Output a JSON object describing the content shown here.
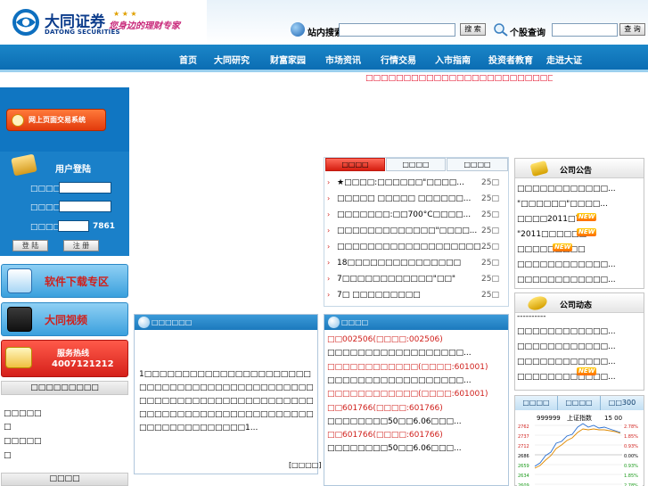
{
  "header": {
    "logo_cn": "大同证券",
    "logo_en": "DATONG SECURITIES",
    "slogan": "您身边的理财专家",
    "site_search_label": "站内搜索",
    "site_search_button": "搜 索",
    "stock_query_label": "个股查询",
    "stock_query_button": "查 询"
  },
  "nav": {
    "items": [
      "首页",
      "大同研究",
      "财富家园",
      "市场资讯",
      "行情交易",
      "入市指南",
      "投资者教育",
      "走进大证"
    ]
  },
  "ticker": "□□□□□□□□□□□□□□□□□□□□□□□□□□□□□□□□□□□□□□□□□□",
  "left": {
    "trade_button": "网上页面交易系统",
    "login": {
      "title": "用户登陆",
      "username_label": "□□□□",
      "password_label": "□□□□",
      "captcha_label": "□□□□",
      "captcha_code": "7861",
      "login_button": "登 陆",
      "register_button": "注 册"
    },
    "download": "软件下载专区",
    "video": "大同视频",
    "hotline_title": "服务热线",
    "hotline_number": "4007121212",
    "section1": "□□□□□□□□□",
    "lines": [
      "□□□□□",
      "□",
      "□□□□□",
      "□"
    ],
    "section2": "□□□□"
  },
  "news": {
    "tabs": [
      "□□□□",
      "□□□□",
      "□□□□"
    ],
    "items": [
      {
        "title": "★□□□□:□□□□□□\"□□□□...",
        "date": "25□"
      },
      {
        "title": "□□□□□ □□□□□ □□□□□□...",
        "date": "25□"
      },
      {
        "title": "□□□□□□□:□□700°C□□□□...",
        "date": "25□"
      },
      {
        "title": "□□□□□□□□□□□□□\"□□□□...",
        "date": "25□"
      },
      {
        "title": "□□□□□□□□□□□□□□□□□□□...",
        "date": "25□"
      },
      {
        "title": "18□□□□□□□□□□□□□□□",
        "date": "25□"
      },
      {
        "title": "7□□□□□□□□□□□□\"□□\"",
        "date": "25□"
      },
      {
        "title": "7□ □□□□□□□□□",
        "date": "25□"
      }
    ]
  },
  "announcements": {
    "title": "公司公告",
    "items": [
      "□□□□□□□□□□□□...",
      "\"□□□□□□\"□□□□...",
      "□□□□2011□7...",
      "\"2011□□□□□□...",
      "□□□□□□□□□",
      "□□□□□□□□□□□□...",
      "□□□□□□□□□□□□...",
      "□□□□□□□□□□□□"
    ],
    "new_badge": "NEW"
  },
  "dynamics": {
    "title": "公司动态",
    "items": [
      "----------",
      "□□□□□□□□□□□□...",
      "□□□□□□□□□□□□...",
      "□□□□□□□□□□□□...",
      "□□□□□□□□□□□□..."
    ]
  },
  "index": {
    "tabs": [
      "□□□□",
      "□□□□",
      "□□300"
    ],
    "code": "999999",
    "name": "上证指数",
    "time": "15 00",
    "left_axis": [
      "2762",
      "2737",
      "2712",
      "2686",
      "2659",
      "2634",
      "2609"
    ],
    "right_axis": [
      "2.78%",
      "1.85%",
      "0.93%",
      "0.00%",
      "0.93%",
      "1.85%",
      "2.78%"
    ],
    "colors": {
      "line": "#2a6fd0",
      "avg": "#e08a00",
      "up": "#d0201c",
      "down": "#1a9a1a"
    }
  },
  "intro": {
    "title": "□□□□□□",
    "body": "1□□□□□□□□□□□□□□□□□□□□□□□□□□□□□□□□□□□□□□□□□□□□□□□□□□□□□□□□□□□□□□□□□□□□□□□□□□□□□□□□□□□□□□□□□□□□□□□□□□□□□□□□□1...",
    "more": "[□□□□]"
  },
  "stock_news": {
    "title": "□□□□",
    "rows": [
      {
        "text": "□□002506(□□□□:002506)",
        "red": true
      },
      {
        "text": "□□□□□□□□□□□□□□□□□□...",
        "red": false
      },
      {
        "text": "□□□□□□□□□□□□(□□□□:601001)",
        "red": true
      },
      {
        "text": "□□□□□□□□□□□□□□□□□□...",
        "red": false
      },
      {
        "text": "□□□□□□□□□□□□(□□□□:601001)",
        "red": true
      },
      {
        "text": "□□601766(□□□□:601766)",
        "red": true
      },
      {
        "text": "□□□□□□□□50□□6.06□□□...",
        "red": false
      },
      {
        "text": "□□601766(□□□□:601766)",
        "red": true
      },
      {
        "text": "□□□□□□□□50□□6.06□□□...",
        "red": false
      }
    ]
  }
}
